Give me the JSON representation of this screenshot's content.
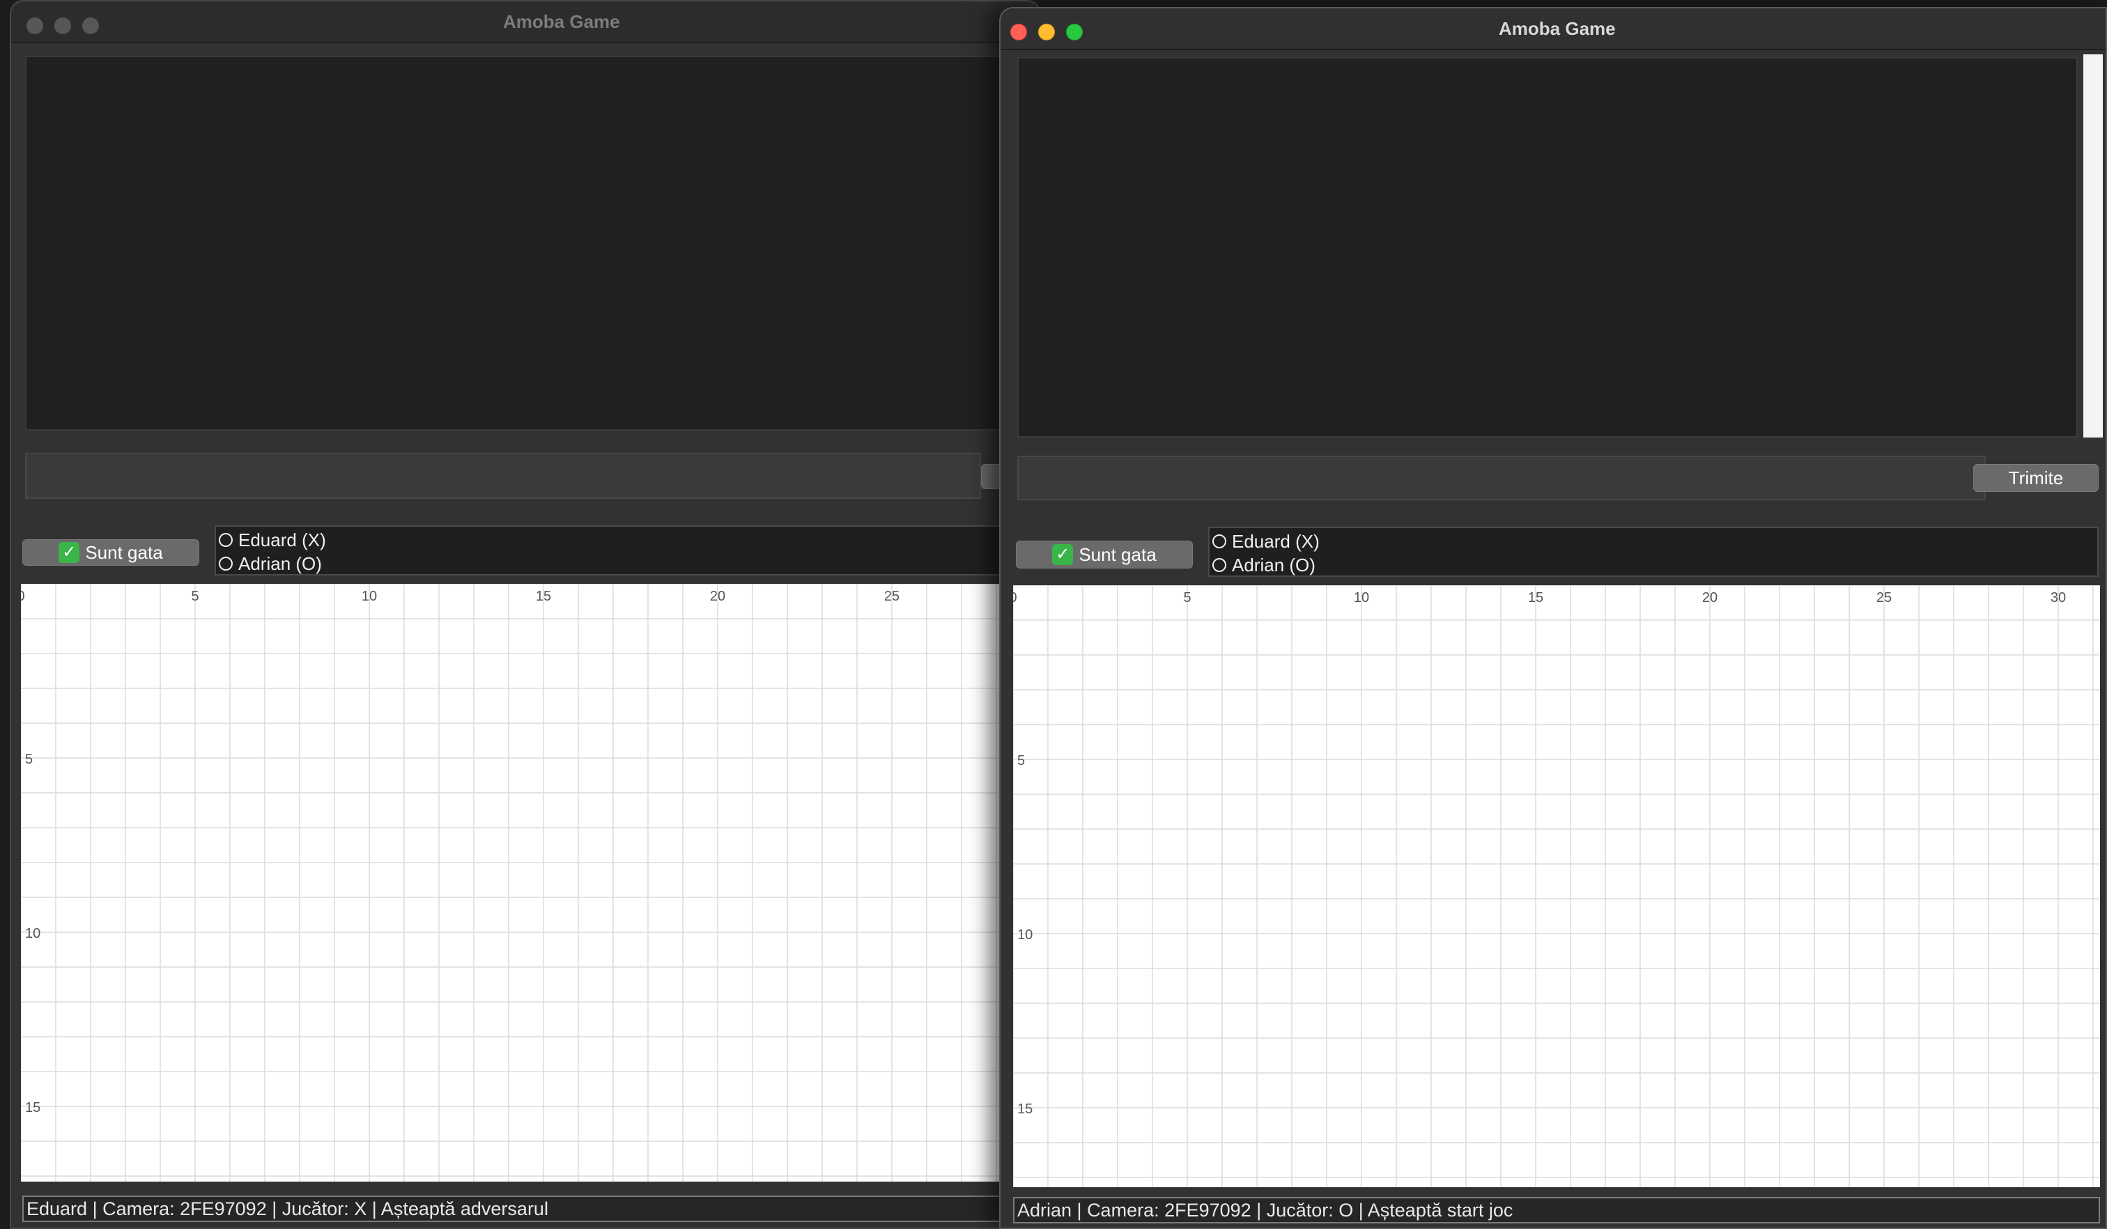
{
  "left_window": {
    "title": "Amoba Game",
    "ready_button": "Sunt gata",
    "players": [
      "Eduard (X)",
      "Adrian (O)"
    ],
    "board": {
      "x_ticks": [
        "0",
        "5",
        "10",
        "15",
        "20",
        "25"
      ],
      "y_ticks": [
        "5",
        "10",
        "15"
      ]
    },
    "status": "Eduard | Camera: 2FE97092 | Jucător: X | Așteaptă adversarul"
  },
  "right_window": {
    "title": "Amoba Game",
    "send_button": "Trimite",
    "ready_button": "Sunt gata",
    "players": [
      "Eduard (X)",
      "Adrian (O)"
    ],
    "board": {
      "x_ticks": [
        "0",
        "5",
        "10",
        "15",
        "20",
        "25",
        "30"
      ],
      "y_ticks": [
        "5",
        "10",
        "15"
      ]
    },
    "status": "Adrian | Camera: 2FE97092 | Jucător: O | Așteaptă start joc"
  },
  "icons": {
    "ready": "check-mark-icon",
    "player_marker": "circle-icon"
  },
  "colors": {
    "close": "#ff5f57",
    "minimize": "#febc2e",
    "maximize": "#28c840",
    "ready_check": "#39b54a",
    "grid_line": "#dcdcdc"
  }
}
